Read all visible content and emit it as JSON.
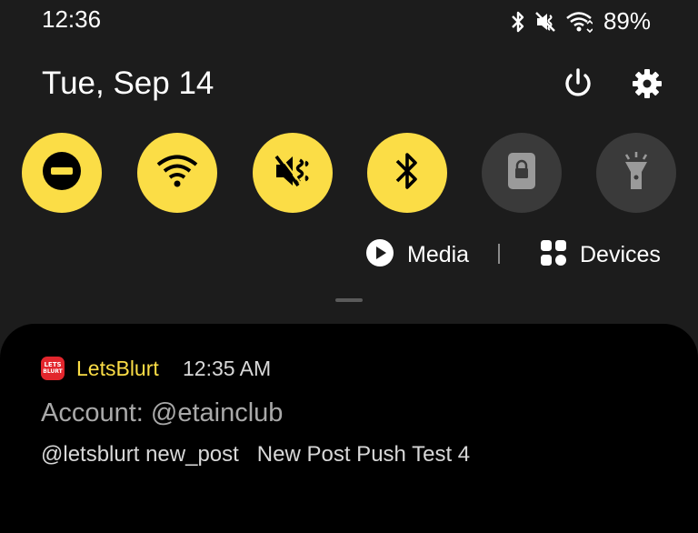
{
  "status_bar": {
    "time": "12:36",
    "battery": "89%",
    "icons": [
      "bluetooth-icon",
      "vibrate-mute-icon",
      "wifi-icon"
    ]
  },
  "header": {
    "date": "Tue, Sep 14",
    "power_icon": "power-icon",
    "settings_icon": "gear-icon"
  },
  "quick_tiles": [
    {
      "name": "do-not-disturb",
      "icon": "minus-circle-icon",
      "state": "on"
    },
    {
      "name": "wifi",
      "icon": "wifi-icon",
      "state": "on"
    },
    {
      "name": "sound-mode",
      "icon": "vibrate-mute-icon",
      "state": "on"
    },
    {
      "name": "bluetooth",
      "icon": "bluetooth-icon",
      "state": "on"
    },
    {
      "name": "secure-folder",
      "icon": "lock-icon",
      "state": "off"
    },
    {
      "name": "flashlight",
      "icon": "flashlight-icon",
      "state": "off"
    }
  ],
  "media_row": {
    "media_label": "Media",
    "devices_label": "Devices"
  },
  "notification": {
    "app_icon_text": [
      "LETS",
      "BLURT"
    ],
    "app_name": "LetsBlurt",
    "time": "12:35 AM",
    "title": "Account: @etainclub",
    "body": "@letsblurt new_post   New Post Push Test 4"
  },
  "colors": {
    "accent": "#fbdd46",
    "tile_off": "#3a3a3a",
    "background": "#1c1c1c",
    "card": "#000000"
  }
}
